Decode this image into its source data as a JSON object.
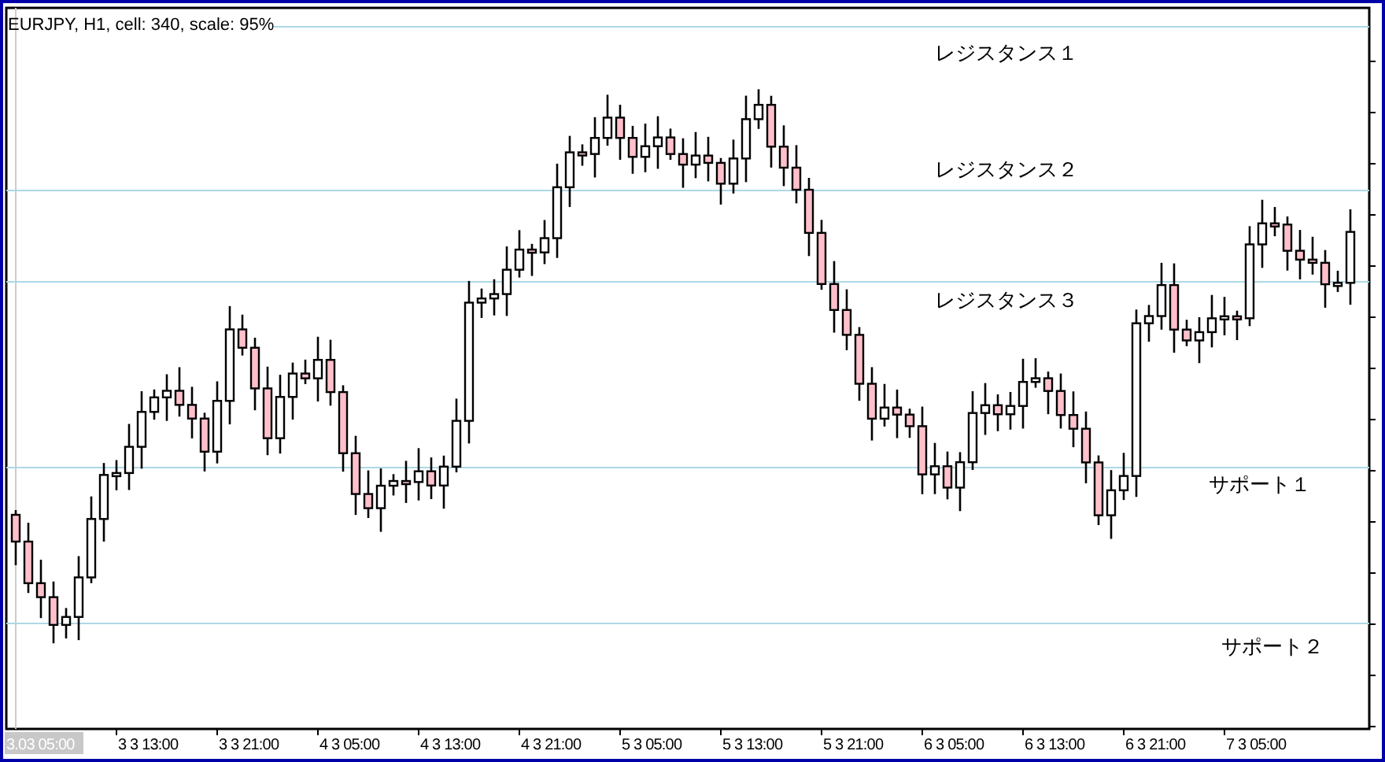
{
  "title": "EURJPY, H1, cell: 340, scale: 95%",
  "x_labels": [
    {
      "text": "3.03 05:00",
      "highlighted": true
    },
    {
      "text": "3 3 13:00",
      "highlighted": false
    },
    {
      "text": "3 3 21:00",
      "highlighted": false
    },
    {
      "text": "4 3 05:00",
      "highlighted": false
    },
    {
      "text": "4 3 13:00",
      "highlighted": false
    },
    {
      "text": "4 3 21:00",
      "highlighted": false
    },
    {
      "text": "5 3 05:00",
      "highlighted": false
    },
    {
      "text": "5 3 13:00",
      "highlighted": false
    },
    {
      "text": "5 3 21:00",
      "highlighted": false
    },
    {
      "text": "6 3 05:00",
      "highlighted": false
    },
    {
      "text": "6 3 13:00",
      "highlighted": false
    },
    {
      "text": "6 3 21:00",
      "highlighted": false
    },
    {
      "text": "7 3 05:00",
      "highlighted": false
    }
  ],
  "levels": [
    {
      "label": "レジスタンス１"
    },
    {
      "label": "レジスタンス２"
    },
    {
      "label": "レジスタンス３"
    },
    {
      "label": "サポート１"
    },
    {
      "label": "サポート２"
    }
  ]
}
